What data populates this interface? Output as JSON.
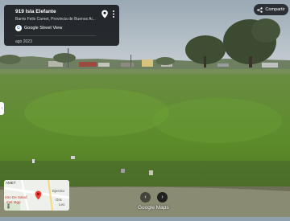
{
  "info": {
    "title": "919 Isla Elefante",
    "subtitle": "Barrio Felix Camet, Provincia de Buenos Ai...",
    "street_view_label": "Google Street View",
    "date": "ago 2023"
  },
  "share": {
    "label": "Compartir"
  },
  "minimap": {
    "label_top": "AMET",
    "label_left": "ntro De Salud",
    "label_left2": "met Mgp",
    "label_right": "Ejercito",
    "label_right2": "Gra",
    "label_right3": "Leo"
  },
  "footer": {
    "brand": "Google Maps"
  },
  "colors": {
    "sky": "#a8b6c2",
    "grass": "#5f8f2c",
    "card": "#121418",
    "accent": "#4285f4"
  },
  "icons": {
    "pin": "map-pin-icon",
    "more": "more-vertical-icon",
    "share": "share-icon",
    "left": "chevron-left-icon",
    "right": "chevron-right-icon",
    "pegman": "pegman-icon"
  }
}
